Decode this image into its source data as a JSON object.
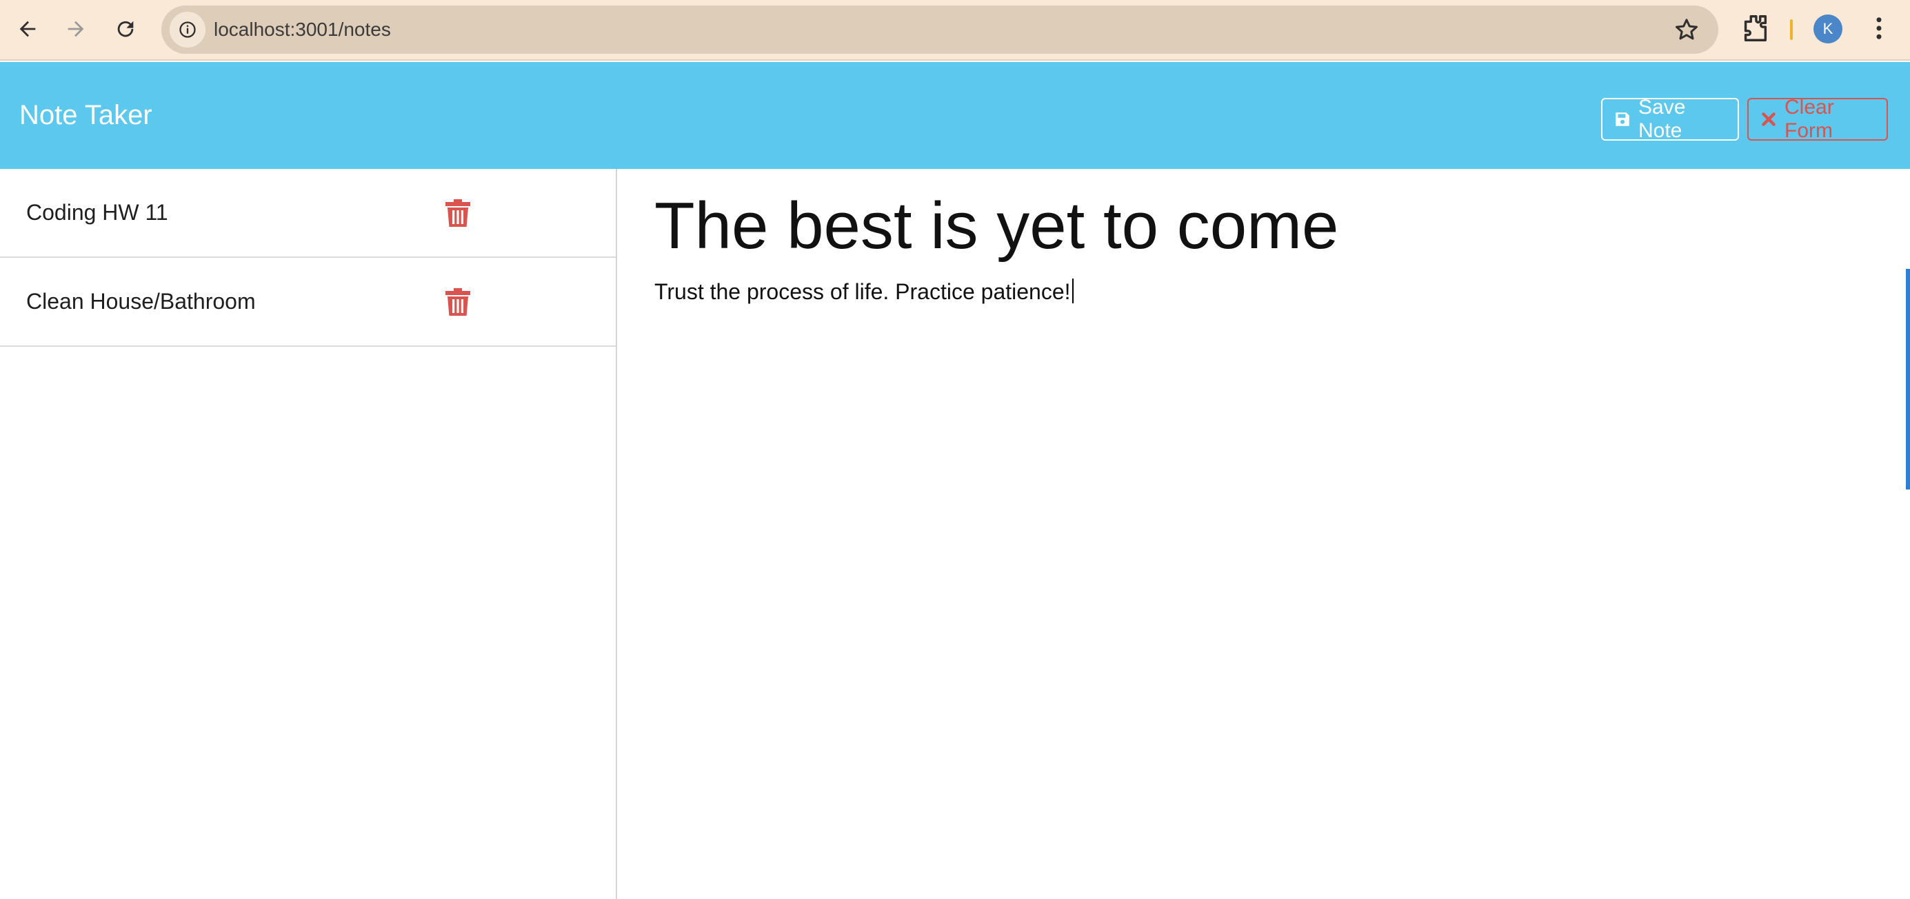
{
  "browser": {
    "url": "localhost:3001/notes",
    "profile_initial": "K",
    "icons": [
      "back-arrow-icon",
      "forward-arrow-icon",
      "reload-icon",
      "info-icon",
      "star-icon",
      "extensions-icon",
      "menu-dots-icon"
    ]
  },
  "app": {
    "brand": "Note Taker",
    "save_label": "Save Note",
    "clear_label": "Clear Form",
    "colors": {
      "navbar": "#5dc8ed",
      "danger": "#d9534f",
      "white": "#ffffff"
    }
  },
  "notes": [
    {
      "title": "Coding HW 11"
    },
    {
      "title": "Clean House/Bathroom"
    }
  ],
  "active_note": {
    "title": "The best is yet to come",
    "text": "Trust the process of life. Practice patience!"
  }
}
